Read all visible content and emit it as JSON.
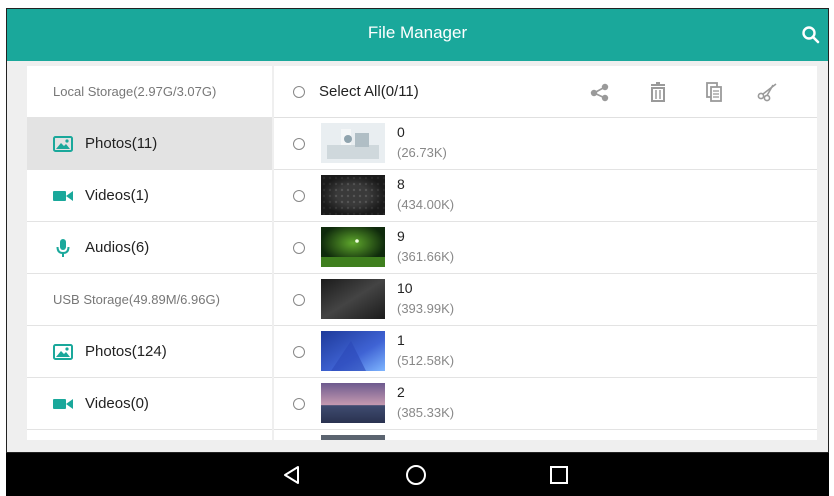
{
  "header": {
    "title": "File Manager",
    "search_icon": "search-icon"
  },
  "sidebar": {
    "sections": [
      {
        "type": "header",
        "label": "Local Storage(2.97G/3.07G)"
      },
      {
        "type": "item",
        "label": "Photos(11)",
        "icon": "image-icon",
        "selected": true
      },
      {
        "type": "item",
        "label": "Videos(1)",
        "icon": "video-camera-icon"
      },
      {
        "type": "item",
        "label": "Audios(6)",
        "icon": "microphone-icon"
      },
      {
        "type": "header",
        "label": "USB Storage(49.89M/6.96G)"
      },
      {
        "type": "item",
        "label": "Photos(124)",
        "icon": "image-icon"
      },
      {
        "type": "item",
        "label": "Videos(0)",
        "icon": "video-camera-icon"
      }
    ]
  },
  "toolbar": {
    "select_all_label": "Select All(0/11)",
    "actions": [
      "share-icon",
      "delete-icon",
      "copy-icon",
      "cut-icon"
    ]
  },
  "files": [
    {
      "name": "0",
      "size": "(26.73K)"
    },
    {
      "name": "8",
      "size": "(434.00K)"
    },
    {
      "name": "9",
      "size": "(361.66K)"
    },
    {
      "name": "10",
      "size": "(393.99K)"
    },
    {
      "name": "1",
      "size": "(512.58K)"
    },
    {
      "name": "2",
      "size": "(385.33K)"
    }
  ],
  "navbar": {
    "buttons": [
      "back-icon",
      "home-icon",
      "recents-icon"
    ]
  },
  "colors": {
    "accent": "#1aa89b",
    "icon": "#1aa89b",
    "nav_bg": "#000000"
  }
}
